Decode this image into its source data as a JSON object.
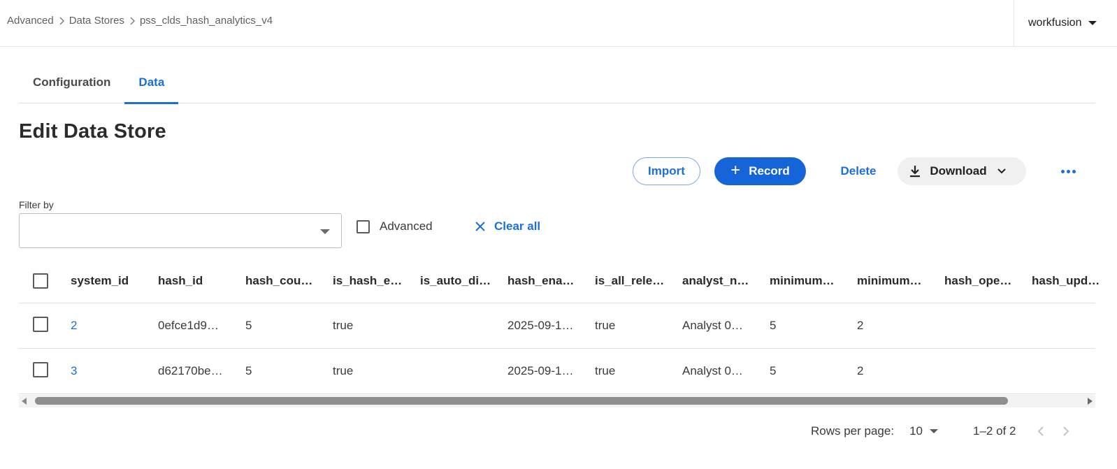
{
  "breadcrumb": {
    "items": [
      "Advanced",
      "Data Stores",
      "pss_clds_hash_analytics_v4"
    ]
  },
  "account": {
    "name": "workfusion"
  },
  "tabs": [
    {
      "label": "Configuration",
      "active": false
    },
    {
      "label": "Data",
      "active": true
    }
  ],
  "page": {
    "title": "Edit Data Store"
  },
  "toolbar": {
    "import_label": "Import",
    "record_label": "Record",
    "delete_label": "Delete",
    "download_label": "Download"
  },
  "filter": {
    "label": "Filter by",
    "value": "",
    "advanced_label": "Advanced",
    "clear_all_label": "Clear all"
  },
  "table": {
    "columns": [
      "system_id",
      "hash_id",
      "hash_cou…",
      "is_hash_e…",
      "is_auto_di…",
      "hash_ena…",
      "is_all_rele…",
      "analyst_n…",
      "minimum…",
      "minimum…",
      "hash_ope…",
      "hash_upd…"
    ],
    "rows": [
      [
        "2",
        "0efce1d9…",
        "5",
        "true",
        "",
        "2025-09-1…",
        "true",
        "Analyst 0…",
        "5",
        "2",
        "",
        ""
      ],
      [
        "3",
        "d62170be…",
        "5",
        "true",
        "",
        "2025-09-1…",
        "true",
        "Analyst 0…",
        "5",
        "2",
        "",
        ""
      ]
    ]
  },
  "pagination": {
    "rows_per_page_label": "Rows per page:",
    "rows_per_page_value": "10",
    "range": "1–2 of 2"
  },
  "colors": {
    "accent": "#1a6fd8",
    "primary_button": "#1565d8"
  }
}
